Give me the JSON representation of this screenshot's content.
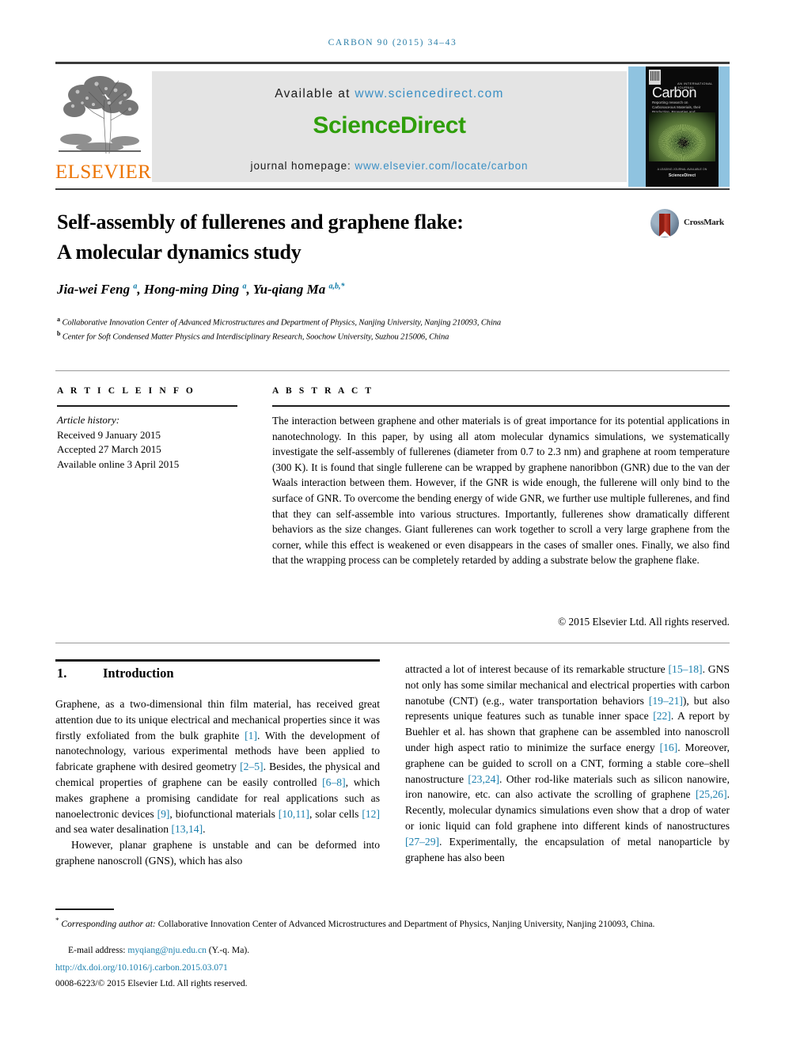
{
  "running_head": "CARBON 90 (2015) 34–43",
  "banner": {
    "publisher_wordmark": "ELSEVIER",
    "available_at_label": "Available at",
    "available_at_url": "www.sciencedirect.com",
    "sciencedirect_logo": "ScienceDirect",
    "homepage_label": "journal homepage:",
    "homepage_url": "www.elsevier.com/locate/carbon",
    "cover": {
      "kicker": "AN INTERNATIONAL JOURNAL",
      "title": "Carbon",
      "subtitle": "Reporting research on Carbonaceous Materials, their Production, Properties and Applications",
      "footer_top": "A LEADING JOURNAL AVAILABLE ON",
      "footer_bottom": "ScienceDirect"
    }
  },
  "article": {
    "title_line1": "Self-assembly of fullerenes and graphene flake:",
    "title_line2": "A molecular dynamics study",
    "crossmark_label": "CrossMark",
    "authors_html": "Jia-wei Feng <sup>a</sup>, Hong-ming Ding <sup>a</sup>, Yu-qiang Ma <sup>a,b,*</sup>",
    "affiliation_a": "Collaborative Innovation Center of Advanced Microstructures and Department of Physics, Nanjing University, Nanjing 210093, China",
    "affiliation_b": "Center for Soft Condensed Matter Physics and Interdisciplinary Research, Soochow University, Suzhou 215006, China"
  },
  "article_info": {
    "heading": "A R T I C L E   I N F O",
    "history_label": "Article history:",
    "received": "Received 9 January 2015",
    "accepted": "Accepted 27 March 2015",
    "available_online": "Available online 3 April 2015"
  },
  "abstract": {
    "heading": "A B S T R A C T",
    "text": "The interaction between graphene and other materials is of great importance for its potential applications in nanotechnology. In this paper, by using all atom molecular dynamics simulations, we systematically investigate the self-assembly of fullerenes (diameter from 0.7 to 2.3 nm) and graphene at room temperature (300 K). It is found that single fullerene can be wrapped by graphene nanoribbon (GNR) due to the van der Waals interaction between them. However, if the GNR is wide enough, the fullerene will only bind to the surface of GNR. To overcome the bending energy of wide GNR, we further use multiple fullerenes, and find that they can self-assemble into various structures. Importantly, fullerenes show dramatically different behaviors as the size changes. Giant fullerenes can work together to scroll a very large graphene from the corner, while this effect is weakened or even disappears in the cases of smaller ones. Finally, we also find that the wrapping process can be completely retarded by adding a substrate below the graphene flake.",
    "copyright": "© 2015 Elsevier Ltd. All rights reserved."
  },
  "body": {
    "section_number": "1.",
    "section_title": "Introduction",
    "left_para1_html": "Graphene, as a two-dimensional thin film material, has received great attention due to its unique electrical and mechanical properties since it was firstly exfoliated from the bulk graphite <span class=\"ref\">[1]</span>. With the development of nanotechnology, various experimental methods have been applied to fabricate graphene with desired geometry <span class=\"ref\">[2–5]</span>. Besides, the physical and chemical properties of graphene can be easily controlled <span class=\"ref\">[6–8]</span>, which makes graphene a promising candidate for real applications such as nanoelectronic devices <span class=\"ref\">[9]</span>, biofunctional materials <span class=\"ref\">[10,11]</span>, solar cells <span class=\"ref\">[12]</span> and sea water desalination <span class=\"ref\">[13,14]</span>.",
    "left_para2_html": "However, planar graphene is unstable and can be deformed into graphene nanoscroll (GNS), which has also",
    "right_para_html": "attracted a lot of interest because of its remarkable structure <span class=\"ref\">[15–18]</span>. GNS not only has some similar mechanical and electrical properties with carbon nanotube (CNT) (e.g., water transportation behaviors <span class=\"ref\">[19–21]</span>), but also represents unique features such as tunable inner space <span class=\"ref\">[22]</span>. A report by Buehler et al. has shown that graphene can be assembled into nanoscroll under high aspect ratio to minimize the surface energy <span class=\"ref\">[16]</span>. Moreover, graphene can be guided to scroll on a CNT, forming a stable core–shell nanostructure <span class=\"ref\">[23,24]</span>. Other rod-like materials such as silicon nanowire, iron nanowire, etc. can also activate the scrolling of graphene <span class=\"ref\">[25,26]</span>. Recently, molecular dynamics simulations even show that a drop of water or ionic liquid can fold graphene into different kinds of nanostructures <span class=\"ref\">[27–29]</span>. Experimentally, the encapsulation of metal nanoparticle by graphene has also been"
  },
  "footnotes": {
    "corresponding_html": "<span class=\"star\">*</span> <span class=\"ital\">Corresponding author at:</span> Collaborative Innovation Center of Advanced Microstructures and Department of Physics, Nanjing University, Nanjing 210093, China.",
    "email_html": "E-mail address: <span class=\"link\">myqiang@nju.edu.cn</span> (Y.-q. Ma).",
    "doi": "http://dx.doi.org/10.1016/j.carbon.2015.03.071",
    "issn_line": "0008-6223/© 2015 Elsevier Ltd. All rights reserved."
  },
  "colors": {
    "running_head": "#2c7fa8",
    "sciencedirect_green": "#2f9e0a",
    "elsevier_orange": "#ec7404",
    "link_blue": "#1a7fad",
    "cover_backing": "#8fc3e0"
  }
}
